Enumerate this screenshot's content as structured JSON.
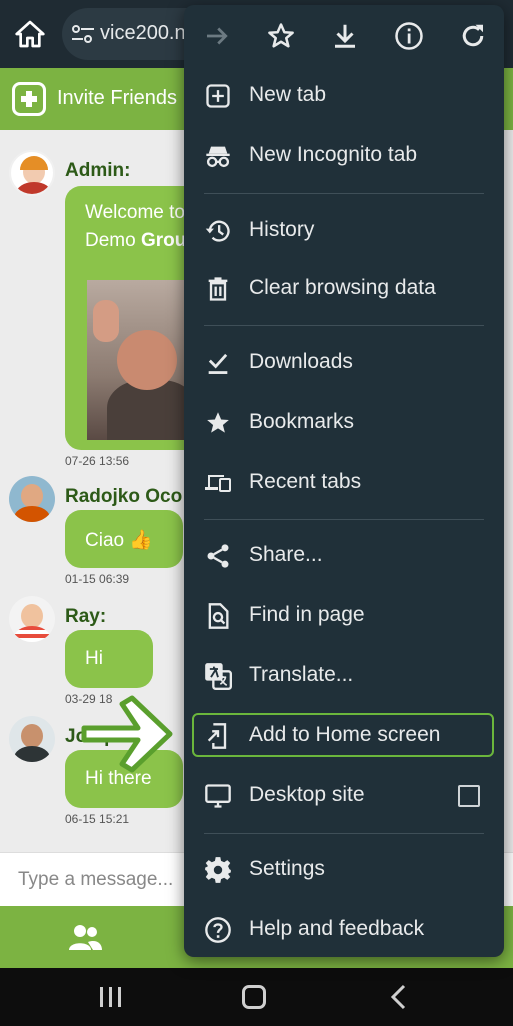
{
  "browser": {
    "url": "vice200.n"
  },
  "page": {
    "invite_label": "Invite Friends",
    "messages": [
      {
        "sender": "Admin:",
        "text_line1": "Welcome to",
        "text_line2_pre": "Demo ",
        "text_line2_bold": "Grou",
        "timestamp": "07-26 13:56"
      },
      {
        "sender": "Radojko Oco",
        "text": "Ciao 👍",
        "timestamp": "01-15 06:39"
      },
      {
        "sender": "Ray:",
        "text": "Hi",
        "timestamp": "03-29 18"
      },
      {
        "sender": "Joaquin",
        "text": "Hi there",
        "timestamp": "06-15 15:21"
      }
    ],
    "message_placeholder": "Type a message..."
  },
  "menu": {
    "items": [
      {
        "label": "New tab",
        "icon": "new-tab-icon"
      },
      {
        "label": "New Incognito tab",
        "icon": "incognito-icon"
      },
      {
        "label": "History",
        "icon": "history-icon"
      },
      {
        "label": "Clear browsing data",
        "icon": "trash-icon"
      },
      {
        "label": "Downloads",
        "icon": "downloads-icon"
      },
      {
        "label": "Bookmarks",
        "icon": "star-filled-icon"
      },
      {
        "label": "Recent tabs",
        "icon": "devices-icon"
      },
      {
        "label": "Share...",
        "icon": "share-icon"
      },
      {
        "label": "Find in page",
        "icon": "find-icon"
      },
      {
        "label": "Translate...",
        "icon": "translate-icon"
      },
      {
        "label": "Add to Home screen",
        "icon": "add-to-home-icon"
      },
      {
        "label": "Desktop site",
        "icon": "desktop-icon"
      },
      {
        "label": "Settings",
        "icon": "gear-icon"
      },
      {
        "label": "Help and feedback",
        "icon": "help-icon"
      }
    ]
  },
  "colors": {
    "menu_bg": "#203039",
    "accent_green": "#7cb342",
    "highlight_border": "#6bb63c"
  }
}
